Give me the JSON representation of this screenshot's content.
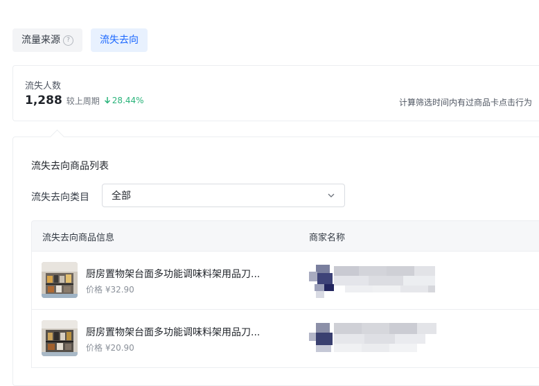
{
  "tabs": [
    {
      "label": "流量来源",
      "active": false,
      "has_help_icon": true
    },
    {
      "label": "流失去向",
      "active": true
    }
  ],
  "stat": {
    "label": "流失人数",
    "value": "1,288",
    "compare_label": "较上周期",
    "change": "28.44%",
    "change_direction": "down",
    "note": "计算筛选时间内有过商品卡点击行为"
  },
  "list": {
    "title": "流失去向商品列表",
    "filter_label": "流失去向类目",
    "filter_value": "全部",
    "columns": {
      "product": "流失去向商品信息",
      "merchant": "商家名称"
    },
    "rows": [
      {
        "name": "厨房置物架台面多功能调味料架用品刀...",
        "price": "价格 ¥32.90"
      },
      {
        "name": "厨房置物架台面多功能调味料架用品刀...",
        "price": "价格 ¥20.90"
      }
    ]
  },
  "colors": {
    "accent": "#1966ff",
    "down_green": "#29b37a",
    "tab_active_bg": "#e8f1fe"
  }
}
